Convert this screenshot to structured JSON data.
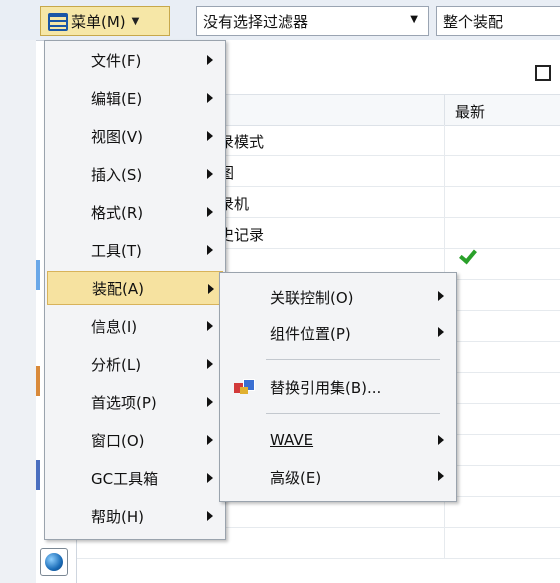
{
  "toolbar": {
    "menu_label": "菜单(M)",
    "menu_icon": "menu-icon",
    "filter_value": "没有选择过滤器",
    "assembly_value": "整个装配"
  },
  "panel": {
    "latest_header": "最新",
    "rows": [
      "录模式",
      "图",
      "录机",
      "史记录",
      ""
    ]
  },
  "menu": {
    "items": [
      {
        "label": "文件(F)"
      },
      {
        "label": "编辑(E)"
      },
      {
        "label": "视图(V)"
      },
      {
        "label": "插入(S)"
      },
      {
        "label": "格式(R)"
      },
      {
        "label": "工具(T)"
      },
      {
        "label": "装配(A)"
      },
      {
        "label": "信息(I)"
      },
      {
        "label": "分析(L)"
      },
      {
        "label": "首选项(P)"
      },
      {
        "label": "窗口(O)"
      },
      {
        "label": "GC工具箱"
      },
      {
        "label": "帮助(H)"
      }
    ]
  },
  "submenu": {
    "items": [
      {
        "label": "关联控制(O)"
      },
      {
        "label": "组件位置(P)"
      },
      {
        "label": "替换引用集(B)..."
      },
      {
        "label": "WAVE"
      },
      {
        "label": "高级(E)"
      }
    ]
  },
  "colors": {
    "highlight": "#f6e2a0",
    "check": "#2aa02a",
    "menu_bg": "#f3f4f6"
  }
}
